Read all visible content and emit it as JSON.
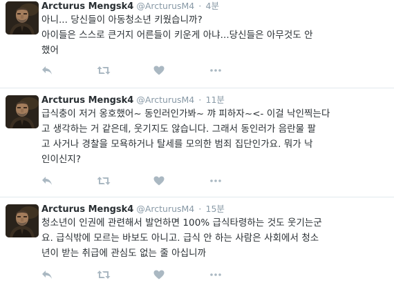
{
  "icons": {
    "reply": "reply-icon",
    "retweet": "retweet-icon",
    "like": "heart-icon",
    "more": "more-icon"
  },
  "colors": {
    "name": "#292f33",
    "meta": "#8899a6",
    "action": "#aab8c2",
    "divider": "#e1e8ed"
  },
  "tweets": [
    {
      "fullname": "Arcturus Mengsk4",
      "username": "@ArcturusM4",
      "dot": "·",
      "time": "4분",
      "lines": [
        "아니... 당신들이 아동청소년 키웠습니까?",
        "아이들은 스스로 큰거지 어른들이 키운게 아냐...당신들은 아무것도 안",
        "했어"
      ]
    },
    {
      "fullname": "Arcturus Mengsk4",
      "username": "@ArcturusM4",
      "dot": "·",
      "time": "11분",
      "lines": [
        "급식충이 저거 옹호했어~ 동인러인가봐~ 꺄 피하자~<- 이걸 낙인찍는다",
        "고 생각하는 거 같은데, 웃기지도 않습니다. 그래서 동인러가 음란물 팔",
        "고 사거나 경찰을 모욕하거나 탈세를 모의한 범죄 집단인가요. 뭐가 낙",
        "인이신지?"
      ]
    },
    {
      "fullname": "Arcturus Mengsk4",
      "username": "@ArcturusM4",
      "dot": "·",
      "time": "15분",
      "lines": [
        "청소년이 인권에 관련해서 발언하면 100% 급식타령하는 것도 웃기는군",
        "요. 급식밖에 모르는 바보도 아니고. 급식 안 하는 사람은 사회에서 청소",
        "년이 받는 취급에 관심도 없는 줄 아십니까"
      ]
    }
  ]
}
